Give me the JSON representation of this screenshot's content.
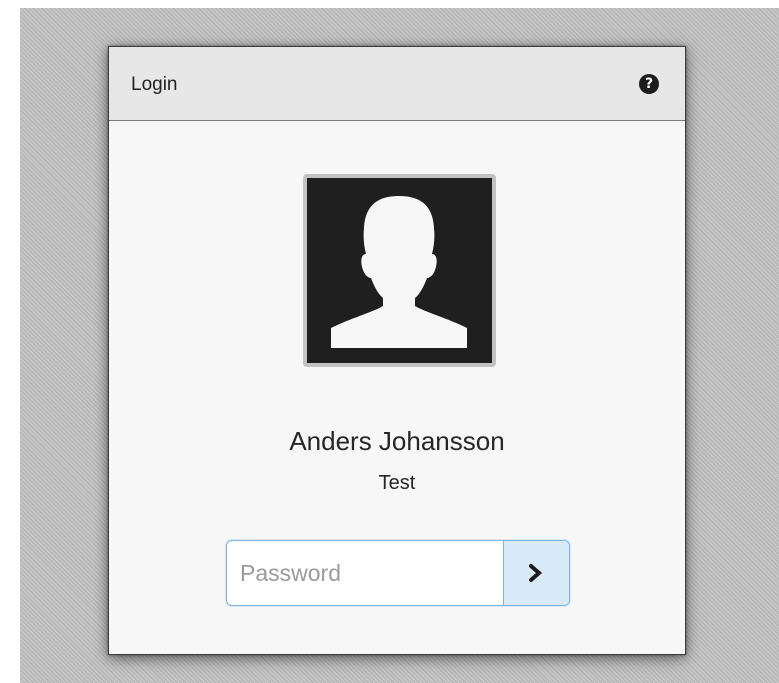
{
  "dialog": {
    "title": "Login",
    "help_icon": "question-circle-icon",
    "help_glyph": "?"
  },
  "user": {
    "avatar_icon": "user-silhouette-icon",
    "name": "Anders Johansson",
    "domain": "Test"
  },
  "password": {
    "value": "",
    "placeholder": "Password",
    "submit_icon": "chevron-right-icon"
  },
  "colors": {
    "background_pattern": "#bdbdbd",
    "dialog_bg": "#f7f7f7",
    "titlebar_bg": "#e7e7e7",
    "avatar_bg": "#1f1f1f",
    "input_focus_border": "#7fb5e6",
    "submit_bg": "#d8e9f8"
  }
}
